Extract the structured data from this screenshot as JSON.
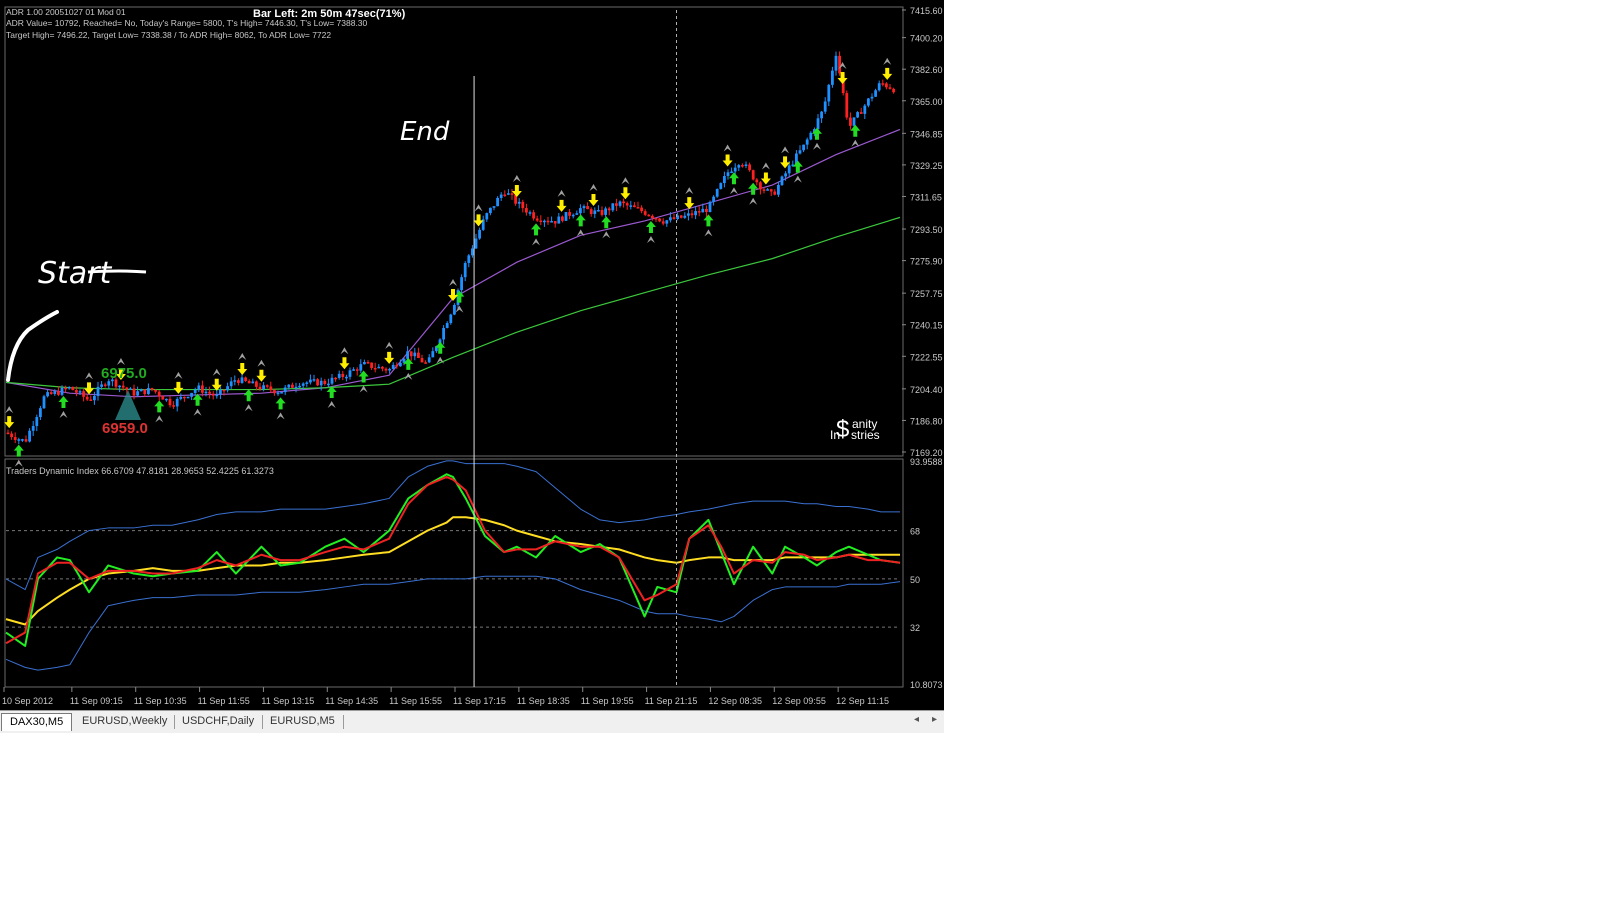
{
  "info": {
    "bar_left": "Bar Left: 2m 50m 47sec(71%)",
    "adr_title": "ADR 1.00 20051027 01 Mod 01",
    "adr_line2": "ADR Value= 10792, Reached= No, Today's Range= 5800, T's High= 7446.30, T's Low= 7388.30",
    "adr_line3": "Target High= 7496.22, Target Low= 7338.38 / To ADR High= 8062, To ADR Low= 7722"
  },
  "annotations": {
    "start": "Start",
    "end": "End"
  },
  "pivot": {
    "upper": "6975.0",
    "lower": "6959.0"
  },
  "logo": {
    "line1": "anity",
    "line2": "In",
    "line3": "stries"
  },
  "colors": {
    "background": "#000000",
    "bull_candle": "#1e90ff",
    "bear_candle": "#ff2020",
    "ma_purple": "#9b59d0",
    "ma_green": "#3cc83c",
    "tdi_green": "#22ee22",
    "tdi_red": "#ee2222",
    "tdi_yellow": "#ffdd22",
    "tdi_bands": "#3a70d0",
    "arrow_up": "#22dd22",
    "arrow_down": "#ffee00",
    "fractal": "#a0a0a0"
  },
  "chart_data": [
    {
      "type": "candlestick",
      "symbol": "DAX30,M5",
      "ylim": [
        7169.2,
        7415.6
      ],
      "price_labels": [
        "7415.60",
        "7400.20",
        "7382.60",
        "7365.00",
        "7346.85",
        "7329.25",
        "7311.65",
        "7293.50",
        "7275.90",
        "7257.75",
        "7240.15",
        "7222.55",
        "7204.40",
        "7186.80",
        "7169.20"
      ],
      "x_labels": [
        "10 Sep 2012",
        "11 Sep 09:15",
        "11 Sep 10:35",
        "11 Sep 11:55",
        "11 Sep 13:15",
        "11 Sep 14:35",
        "11 Sep 15:55",
        "11 Sep 17:15",
        "11 Sep 18:35",
        "11 Sep 19:55",
        "11 Sep 21:15",
        "12 Sep 08:35",
        "12 Sep 09:55",
        "12 Sep 11:15"
      ],
      "series": [
        {
          "kind": "close_path",
          "x": [
            0,
            0.3,
            0.6,
            1,
            1.3,
            1.6,
            2,
            2.3,
            2.6,
            3,
            3.3,
            3.6,
            4,
            4.3,
            4.6,
            5,
            5.3,
            5.6,
            6,
            6.3,
            6.6,
            7,
            7.2,
            7.5,
            7.8,
            8,
            8.3,
            8.6,
            9,
            9.3,
            9.6,
            10,
            10.3,
            10.6,
            11,
            11.3,
            11.5,
            11.8,
            12,
            12.3,
            12.5,
            12.8,
            13,
            13.2,
            13.5,
            13.7,
            14
          ],
          "values": [
            7180,
            7175,
            7200,
            7205,
            7198,
            7210,
            7202,
            7204,
            7196,
            7205,
            7200,
            7210,
            7205,
            7203,
            7208,
            7208,
            7212,
            7218,
            7215,
            7225,
            7218,
            7250,
            7275,
            7300,
            7315,
            7308,
            7300,
            7298,
            7305,
            7302,
            7308,
            7303,
            7298,
            7300,
            7305,
            7325,
            7332,
            7318,
            7312,
            7330,
            7340,
            7360,
            7392,
            7350,
            7365,
            7375,
            7370
          ]
        },
        {
          "kind": "ma_purple",
          "x": [
            0,
            1,
            2,
            3,
            4,
            5,
            6,
            7,
            8,
            9,
            10,
            11,
            12,
            13,
            14
          ],
          "values": [
            7208,
            7202,
            7200,
            7201,
            7202,
            7205,
            7212,
            7255,
            7275,
            7290,
            7298,
            7308,
            7318,
            7335,
            7349
          ]
        },
        {
          "kind": "ma_green",
          "x": [
            0,
            1,
            2,
            3,
            4,
            5,
            6,
            7,
            8,
            9,
            10,
            11,
            12,
            13,
            14
          ],
          "values": [
            7208,
            7205,
            7204,
            7204,
            7204,
            7205,
            7207,
            7222,
            7236,
            7248,
            7258,
            7268,
            7277,
            7289,
            7300
          ]
        }
      ],
      "vertical_lines": [
        {
          "x": 7.33,
          "style": "solid"
        },
        {
          "x": 10.5,
          "style": "dashed"
        }
      ]
    },
    {
      "type": "line",
      "title": "Traders Dynamic Index 66.6709 47.8181 28.9653 52.4225 61.3273",
      "ylim": [
        10.8073,
        93.9588
      ],
      "y_labels": [
        "93.9588",
        "68",
        "50",
        "32",
        "10.8073"
      ],
      "levels": [
        68,
        50,
        32
      ],
      "x": [
        0,
        0.3,
        0.5,
        0.8,
        1,
        1.3,
        1.6,
        2,
        2.3,
        2.6,
        3,
        3.3,
        3.6,
        4,
        4.3,
        4.6,
        5,
        5.3,
        5.6,
        6,
        6.3,
        6.6,
        6.9,
        7,
        7.2,
        7.5,
        7.8,
        8,
        8.3,
        8.6,
        9,
        9.3,
        9.6,
        10,
        10.2,
        10.5,
        10.7,
        11,
        11.2,
        11.4,
        11.7,
        12,
        12.2,
        12.5,
        12.7,
        13,
        13.2,
        13.5,
        13.7,
        14
      ],
      "series": [
        {
          "name": "green",
          "values": [
            30,
            25,
            50,
            58,
            57,
            45,
            55,
            52,
            51,
            52,
            53,
            60,
            52,
            62,
            55,
            56,
            62,
            65,
            60,
            68,
            80,
            85,
            89,
            88,
            80,
            66,
            60,
            62,
            58,
            66,
            60,
            63,
            58,
            36,
            47,
            45,
            65,
            72,
            60,
            48,
            62,
            52,
            62,
            58,
            55,
            60,
            62,
            59,
            57,
            56
          ]
        },
        {
          "name": "red",
          "values": [
            26,
            30,
            52,
            56,
            56,
            50,
            53,
            53,
            52,
            52,
            54,
            57,
            55,
            59,
            57,
            57,
            60,
            62,
            61,
            65,
            78,
            85,
            88,
            87,
            83,
            68,
            60,
            61,
            61,
            64,
            62,
            62,
            58,
            42,
            44,
            48,
            65,
            70,
            62,
            52,
            57,
            56,
            60,
            59,
            57,
            58,
            59,
            57,
            57,
            56
          ]
        },
        {
          "name": "yellow",
          "values": [
            35,
            33,
            38,
            43,
            46,
            50,
            52,
            53,
            54,
            53,
            53,
            54,
            55,
            55,
            56,
            56,
            57,
            58,
            59,
            60,
            64,
            68,
            71,
            73,
            73,
            72,
            70,
            68,
            66,
            64,
            63,
            62,
            61,
            58,
            57,
            56,
            57,
            58,
            58,
            57,
            57,
            57,
            58,
            58,
            58,
            58,
            59,
            59,
            59,
            59
          ]
        },
        {
          "name": "upper_band",
          "values": [
            50,
            46,
            58,
            61,
            64,
            68,
            69,
            69,
            70,
            70,
            72,
            74,
            75,
            75,
            76,
            76,
            76,
            77,
            78,
            80,
            88,
            92,
            94,
            94,
            93,
            93,
            93,
            92,
            90,
            84,
            76,
            72,
            71,
            72,
            73,
            74,
            75,
            76,
            77,
            78,
            79,
            79,
            79,
            78,
            78,
            77,
            77,
            76,
            75,
            75
          ]
        },
        {
          "name": "lower_band",
          "values": [
            20,
            17,
            16,
            17,
            18,
            30,
            40,
            42,
            43,
            43,
            44,
            44,
            44,
            45,
            45,
            45,
            46,
            47,
            48,
            48,
            49,
            50,
            50,
            50,
            50,
            51,
            51,
            51,
            51,
            50,
            46,
            44,
            42,
            38,
            37,
            37,
            36,
            35,
            34,
            36,
            42,
            46,
            47,
            47,
            47,
            47,
            48,
            48,
            48,
            49
          ]
        }
      ]
    }
  ],
  "signals": {
    "up_arrows": [
      0.2,
      0.9,
      2.4,
      3.0,
      3.8,
      4.3,
      5.1,
      5.6,
      6.3,
      6.8,
      7.1,
      8.3,
      9.0,
      9.4,
      10.1,
      11.0,
      11.4,
      11.7,
      12.4,
      12.7,
      13.3
    ],
    "down_arrows": [
      0.05,
      1.3,
      1.8,
      2.7,
      3.3,
      3.7,
      4.0,
      5.3,
      6.0,
      7.0,
      7.4,
      8.0,
      8.7,
      9.2,
      9.7,
      10.7,
      11.3,
      11.9,
      12.2,
      13.1,
      13.8
    ]
  },
  "tabs": [
    "DAX30,M5",
    "EURUSD,Weekly",
    "USDCHF,Daily",
    "EURUSD,M5"
  ],
  "nav": {
    "left": "◂",
    "right": "▸"
  }
}
